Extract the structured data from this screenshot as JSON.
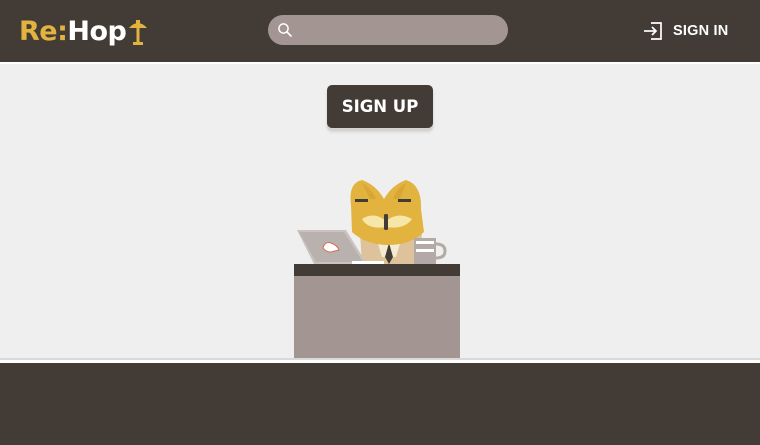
{
  "header": {
    "logo": {
      "part1": "Re:",
      "part2": "Hop"
    },
    "search": {
      "placeholder": "",
      "value": ""
    },
    "signin_label": "SIGN IN"
  },
  "main": {
    "signup_label": "SIGN UP"
  },
  "colors": {
    "header_bg": "#433c36",
    "brand_accent": "#e2b43f",
    "search_bg": "#a39592",
    "page_bg": "#efefef",
    "desk_top": "#433c36",
    "desk_body": "#a39592"
  },
  "icons": {
    "logo_lamp": "desk-lamp-icon",
    "search": "search-icon",
    "signin": "sign-in-icon"
  }
}
